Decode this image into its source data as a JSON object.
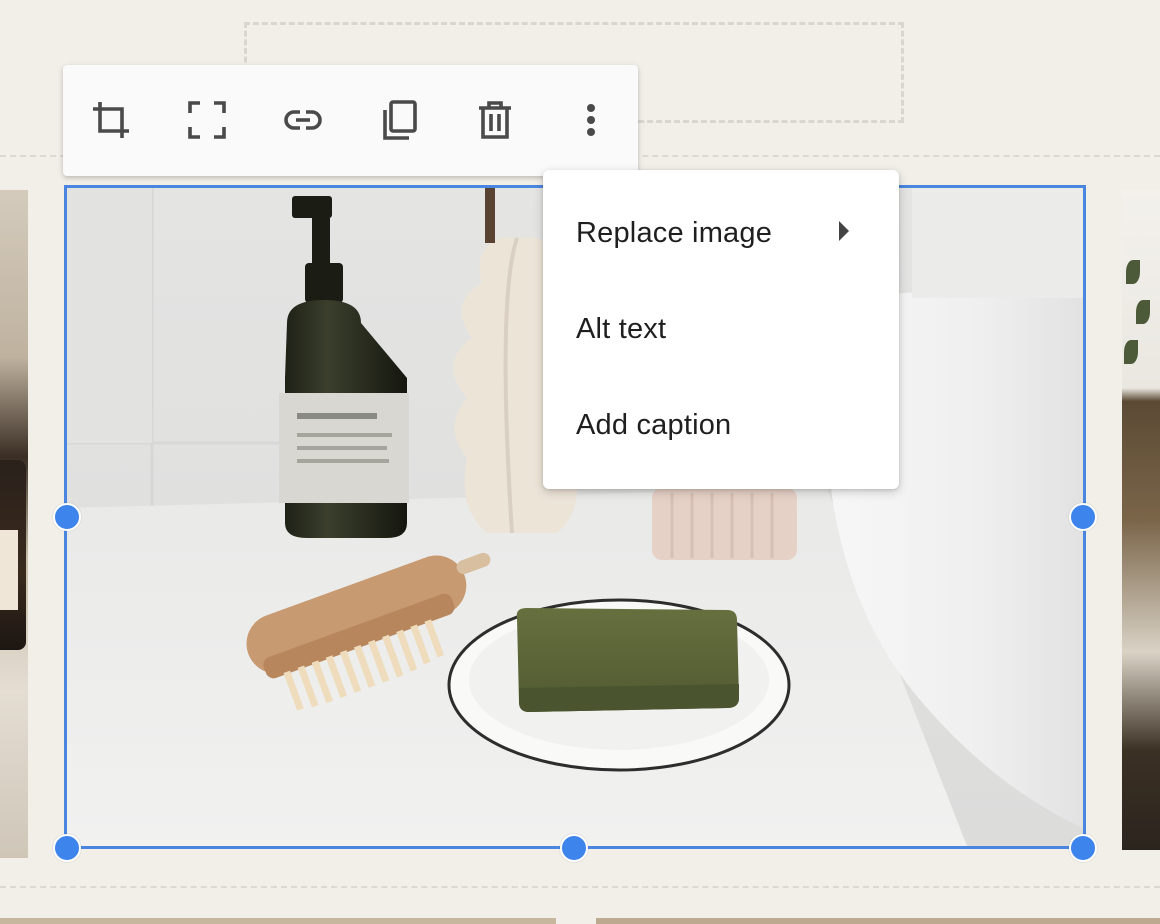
{
  "toolbar": {
    "buttons": [
      {
        "icon": "crop-icon"
      },
      {
        "icon": "fullscreen-icon"
      },
      {
        "icon": "link-icon"
      },
      {
        "icon": "duplicate-icon"
      },
      {
        "icon": "delete-icon"
      },
      {
        "icon": "more-vertical-icon"
      }
    ]
  },
  "context_menu": {
    "items": [
      {
        "label": "Replace image",
        "has_submenu": true
      },
      {
        "label": "Alt text"
      },
      {
        "label": "Add caption"
      }
    ]
  },
  "colors": {
    "selection_accent": "#4a86e0",
    "handle": "#3d84ec",
    "canvas_background": "#f2efe9",
    "icon": "#4a4a4a"
  }
}
